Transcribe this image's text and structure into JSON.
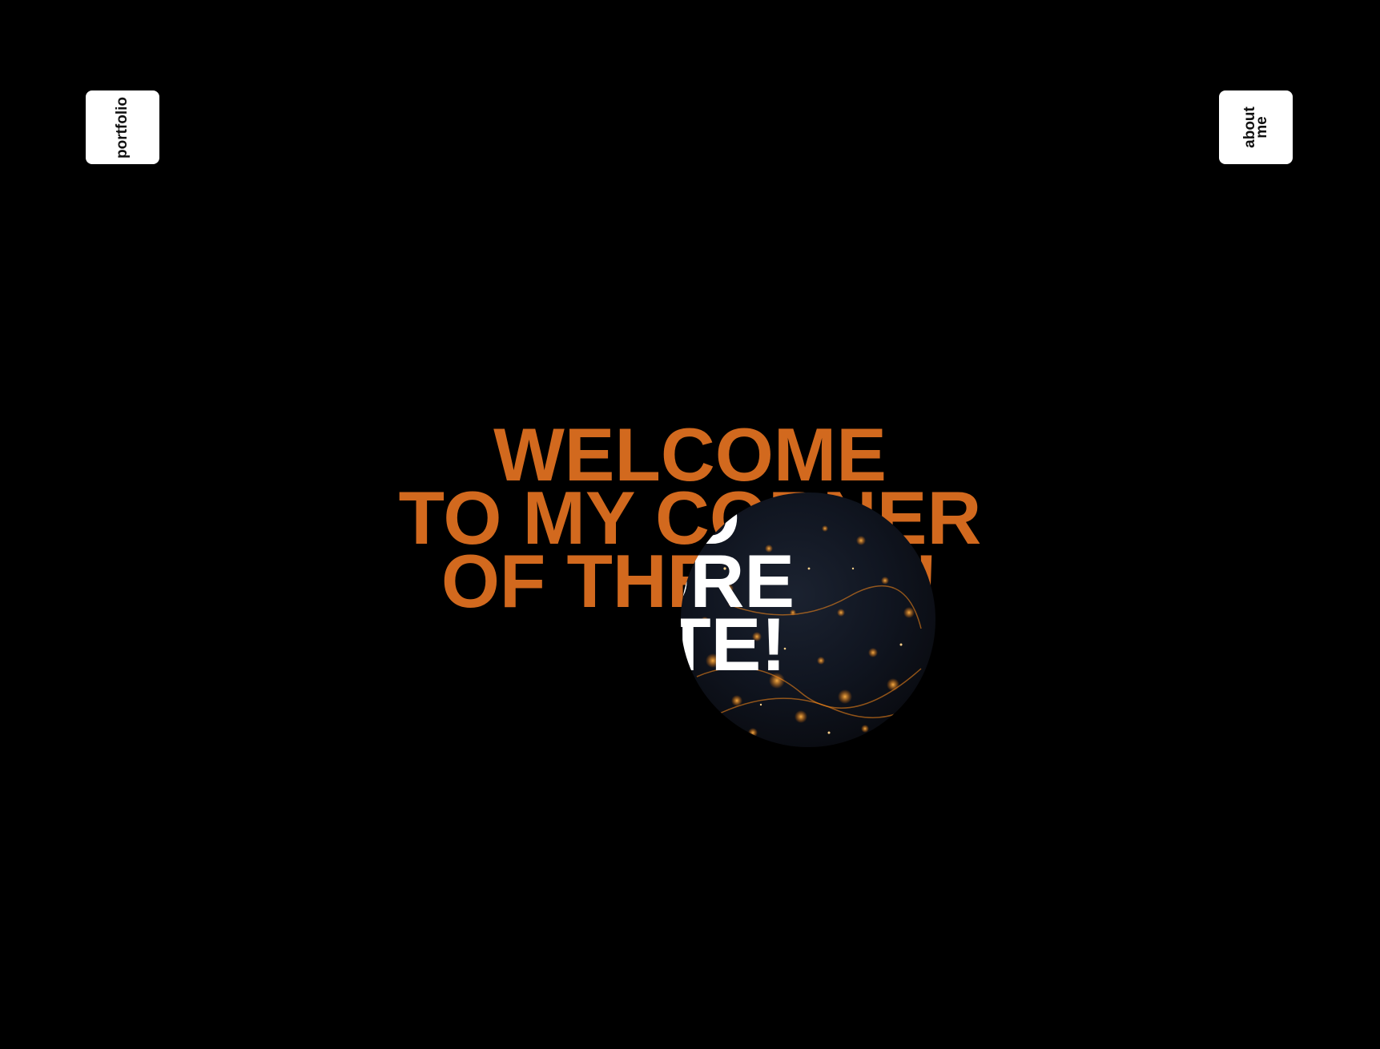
{
  "nav": {
    "portfolio_label": "portfolio",
    "about_label_line1": "about",
    "about_label_line2": "me"
  },
  "hero": {
    "line1": "WELCOME",
    "line2": "TO MY CORNER",
    "line3": "OF THE WEB!"
  },
  "reveal": {
    "line1": "",
    "line2": "  LD",
    "line3": "  LORE",
    "line4": "  SITE!"
  },
  "colors": {
    "background": "#000000",
    "accent": "#d2691e",
    "button_bg": "#ffffff",
    "reveal_text": "#ffffff"
  }
}
